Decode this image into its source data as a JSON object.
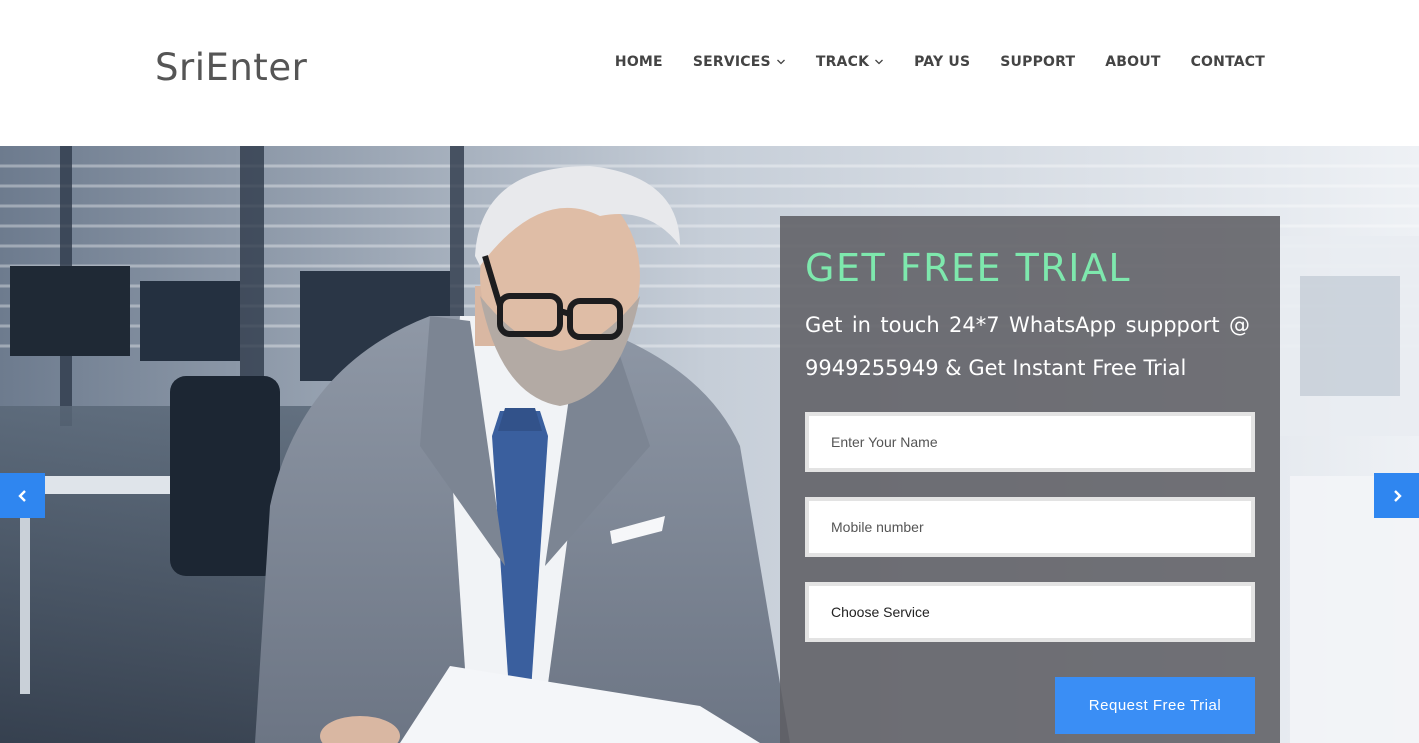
{
  "brand": {
    "name": "SriEnter"
  },
  "nav": {
    "items": [
      {
        "label": "HOME",
        "has_dropdown": false
      },
      {
        "label": "SERVICES",
        "has_dropdown": true
      },
      {
        "label": "TRACK",
        "has_dropdown": true
      },
      {
        "label": "PAY US",
        "has_dropdown": false
      },
      {
        "label": "SUPPORT",
        "has_dropdown": false
      },
      {
        "label": "ABOUT",
        "has_dropdown": false
      },
      {
        "label": "CONTACT",
        "has_dropdown": false
      }
    ]
  },
  "hero": {
    "carousel": {
      "prev_icon": "chevron-left-icon",
      "next_icon": "chevron-right-icon"
    },
    "form": {
      "title": "GET FREE TRIAL",
      "description": "Get in touch 24*7 WhatsApp suppport @ 9949255949 & Get Instant Free Trial",
      "name_placeholder": "Enter Your Name",
      "mobile_placeholder": "Mobile number",
      "service_selected": "Choose Service",
      "submit_label": "Request Free Trial"
    }
  },
  "colors": {
    "accent_blue": "#3a8ef5",
    "title_green": "#7ee8ad",
    "panel_bg": "#5f5f64",
    "nav_text": "#444444",
    "logo_text": "#555555"
  }
}
